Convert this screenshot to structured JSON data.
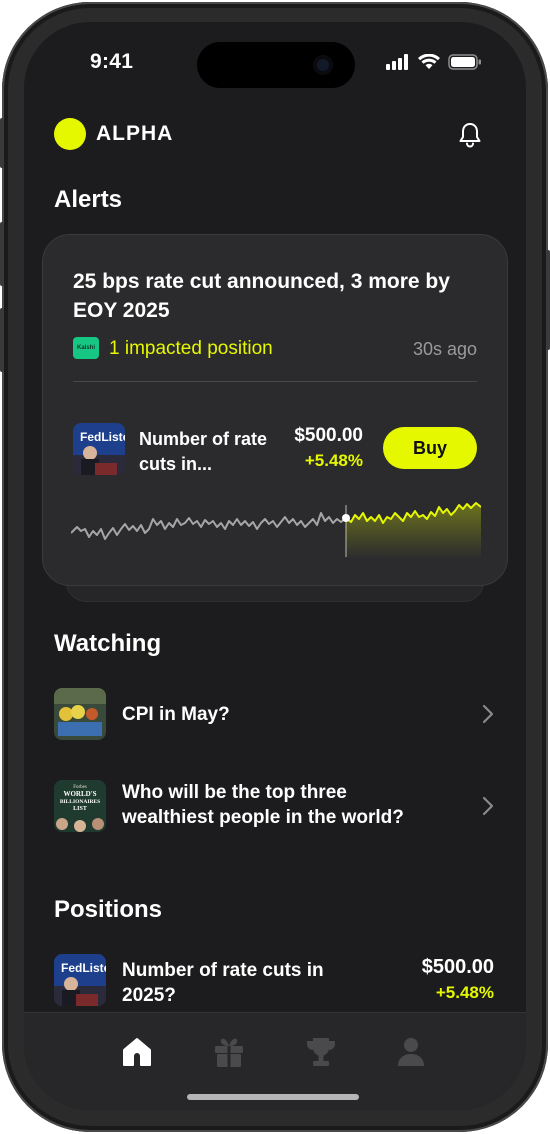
{
  "status_bar": {
    "time": "9:41"
  },
  "header": {
    "app_name": "ALPHA",
    "icons": [
      "bell-icon"
    ]
  },
  "alerts": {
    "section_title": "Alerts",
    "card": {
      "title": "25 bps rate cut announced, 3 more by EOY 2025",
      "source_badge": "Kalshi",
      "impacted_text": "1 impacted position",
      "time_ago": "30s ago",
      "market": {
        "name": "Number of rate cuts in...",
        "price": "$500.00",
        "change": "+5.48%",
        "thumbnail_text": "FedListen"
      },
      "buy_label": "Buy"
    }
  },
  "watching": {
    "section_title": "Watching",
    "items": [
      {
        "title": "CPI in May?"
      },
      {
        "title": "Who will be the top three wealthiest people in the world?",
        "thumbnail_lines": [
          "Forbes",
          "WORLD'S",
          "BILLIONAIRES",
          "LIST"
        ]
      }
    ]
  },
  "positions": {
    "section_title": "Positions",
    "items": [
      {
        "title": "Number of rate cuts in 2025?",
        "price": "$500.00",
        "change": "+5.48%",
        "thumbnail_text": "FedListen"
      }
    ]
  },
  "tabbar": {
    "tabs": [
      "home-icon",
      "gift-icon",
      "trophy-icon",
      "profile-icon"
    ],
    "active": "home-icon"
  },
  "colors": {
    "accent": "#e6f800",
    "background": "#1c1c1e",
    "card": "#2b2b2d",
    "muted": "#9a9a9c"
  }
}
